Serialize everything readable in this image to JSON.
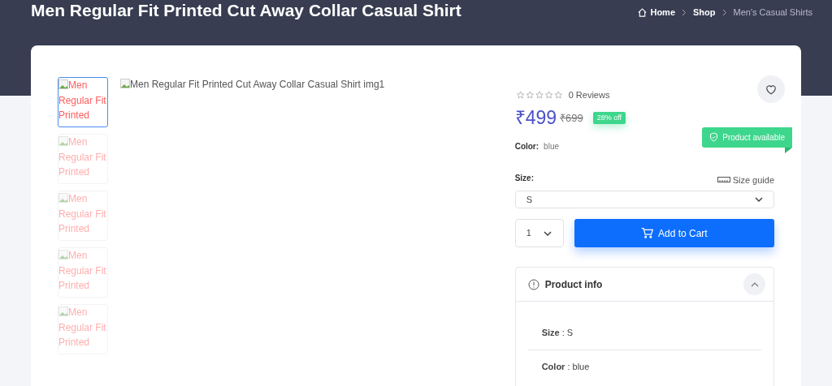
{
  "page_title": "Men Regular Fit Printed Cut Away Collar Casual Shirt",
  "breadcrumb": [
    {
      "label": "Home",
      "current": false
    },
    {
      "label": "Shop",
      "current": false
    },
    {
      "label": "Men's Casual Shirts",
      "current": true
    }
  ],
  "thumbnails": [
    {
      "alt": "Men Regular Fit Printed",
      "selected": true
    },
    {
      "alt": "Men Regular Fit Printed",
      "selected": false
    },
    {
      "alt": "Men Regular Fit Printed",
      "selected": false
    },
    {
      "alt": "Men Regular Fit Printed",
      "selected": false
    },
    {
      "alt": "Men Regular Fit Printed",
      "selected": false
    }
  ],
  "main_image": {
    "alt": "Men Regular Fit Printed Cut Away Collar Casual Shirt img1"
  },
  "rating": {
    "stars": 0,
    "reviews": "0 Reviews"
  },
  "price": {
    "current": "₹499",
    "original": "₹699",
    "discount": "28% off"
  },
  "color": {
    "label": "Color:",
    "value": "blue"
  },
  "availability": "Product available",
  "size": {
    "label": "Size:",
    "guide": "Size guide",
    "value": "S"
  },
  "quantity": "1",
  "add_to_cart": "Add to Cart",
  "product_info": {
    "title": "Product info",
    "expanded": true,
    "rows": [
      "**Size** : S",
      "**Color** : blue"
    ]
  }
}
